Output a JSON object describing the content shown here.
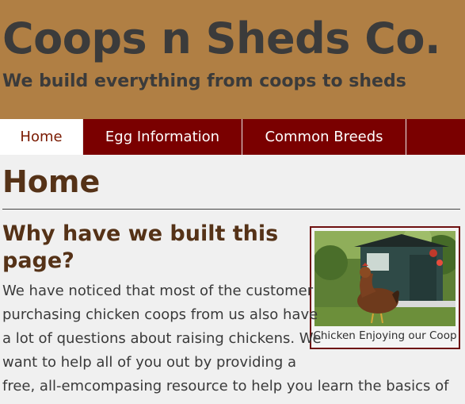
{
  "header": {
    "site_title": "Coops n Sheds Co.",
    "tagline": "We build everything from coops to sheds"
  },
  "nav": {
    "items": [
      {
        "label": "Home",
        "active": true
      },
      {
        "label": "Egg Information",
        "active": false
      },
      {
        "label": "Common Breeds",
        "active": false
      }
    ]
  },
  "main": {
    "page_title": "Home",
    "section_heading": "Why have we built this page?",
    "paragraph_lines": [
      "We have noticed that most of the customer",
      "purchasing chicken coops from us also have",
      "a lot of questions about raising chickens. We",
      "want to help all of you out by providing a",
      "free, all-emcompasing resource to help you learn the basics of"
    ],
    "figure": {
      "caption": "Chicken Enjoying our Coop"
    }
  },
  "colors": {
    "banner": "#b07f44",
    "nav_background": "#7a0000",
    "heading": "#553217",
    "page_background": "#f0f0f0"
  }
}
